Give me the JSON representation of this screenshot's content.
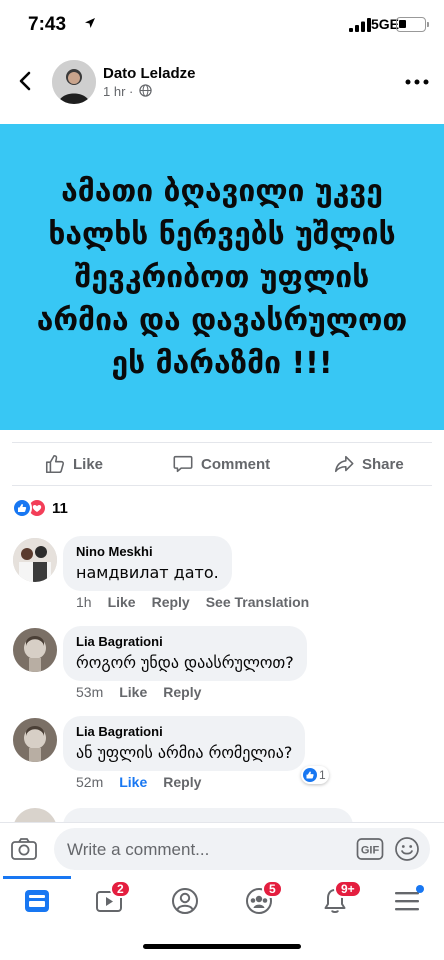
{
  "status_bar": {
    "time": "7:43",
    "network": "5GE"
  },
  "post": {
    "author": "Dato Leladze",
    "timestamp": "1 hr",
    "separator": "·",
    "text_lines": [
      "ამათი ბღავილი უკვე",
      "ხალხს ნერვებს უშლის",
      "შევკრიბოთ უფლის",
      "არმია და  დავასრულოთ",
      "ეს მარაზმი !!!"
    ],
    "background_color": "#38c7f4"
  },
  "actions": {
    "like": "Like",
    "comment": "Comment",
    "share": "Share"
  },
  "reactions": {
    "count": "11",
    "types": [
      "like-icon",
      "love-icon"
    ]
  },
  "comments": [
    {
      "author": "Nino Meskhi",
      "text": "намдвилат  дато.",
      "time": "1h",
      "like": "Like",
      "reply": "Reply",
      "translate": "See Translation"
    },
    {
      "author": "Lia Bagrationi",
      "text": "როგორ უნდა დაასრულოთ?",
      "time": "53m",
      "like": "Like",
      "reply": "Reply"
    },
    {
      "author": "Lia Bagrationi",
      "text": "ან უფლის არმია რომელია?",
      "time": "52m",
      "like": "Like",
      "reply": "Reply",
      "like_count": "1",
      "liked": true
    }
  ],
  "composer": {
    "placeholder": "Write a comment...",
    "gif_label": "GIF"
  },
  "tab_bar": {
    "items": [
      "news-feed-icon",
      "watch-icon",
      "profile-icon",
      "groups-icon",
      "notifications-icon",
      "menu-icon"
    ],
    "badges": {
      "watch": "2",
      "groups": "5",
      "notifications": "9+"
    },
    "accent": "#1877f2"
  }
}
